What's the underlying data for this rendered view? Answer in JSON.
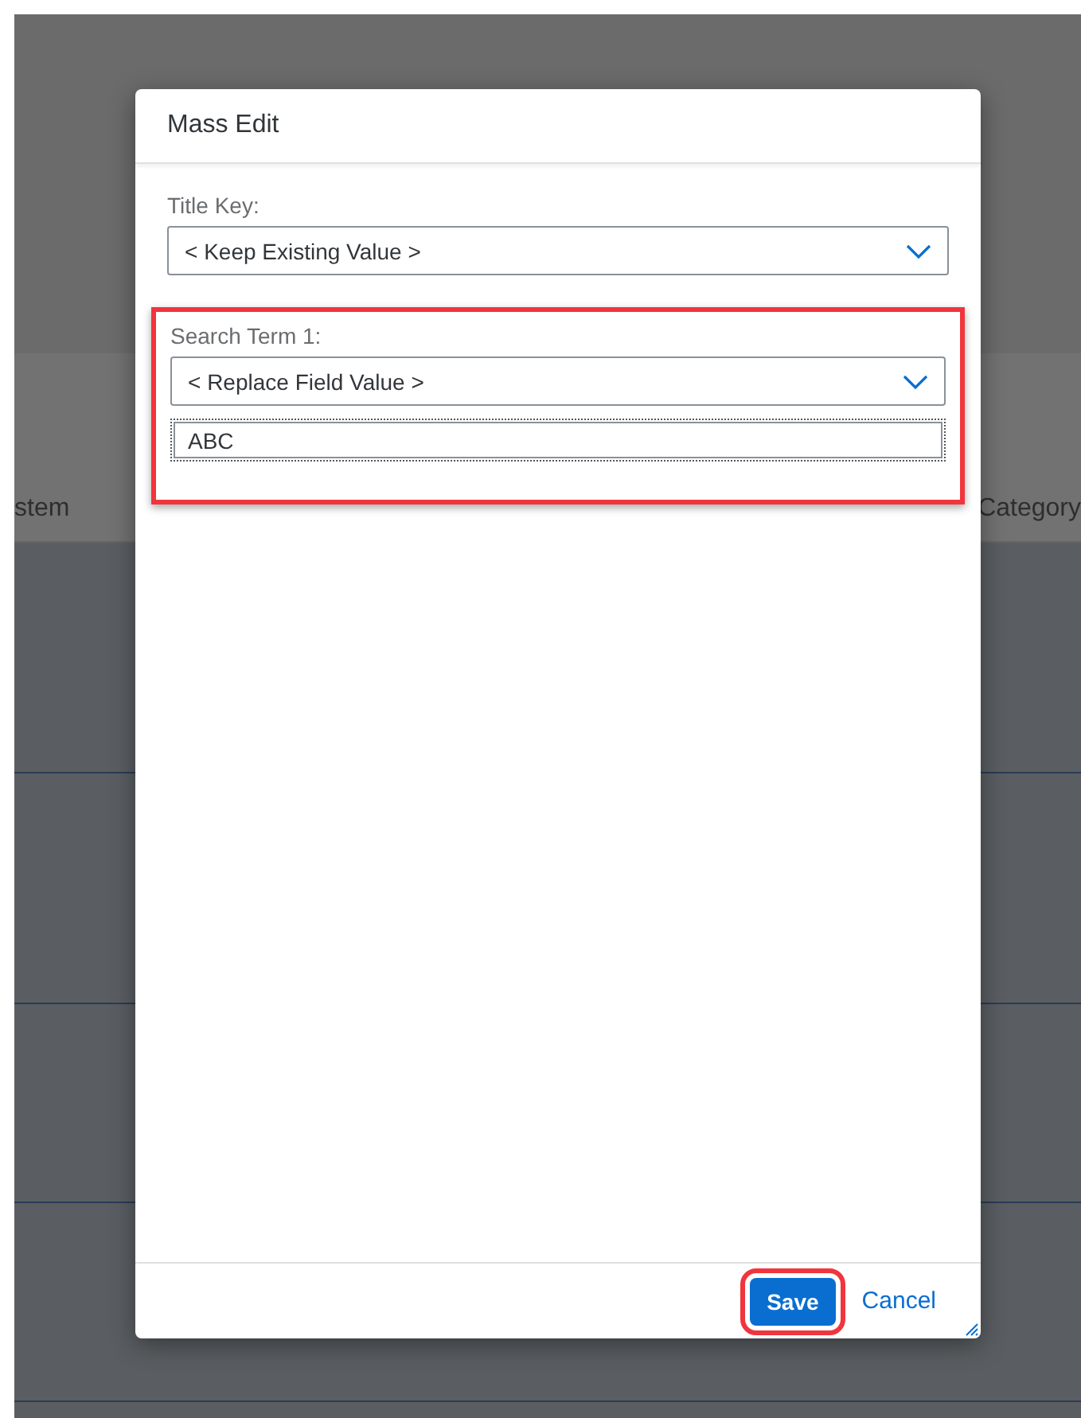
{
  "background": {
    "columns": [
      {
        "label": "stem"
      },
      {
        "label": "Category"
      }
    ]
  },
  "dialog": {
    "title": "Mass Edit",
    "fields": [
      {
        "label": "Title Key:",
        "value": "< Keep Existing Value >",
        "highlighted": false
      },
      {
        "label": "Search Term 1:",
        "value": "< Replace Field Value >",
        "input": "ABC",
        "highlighted": true
      }
    ],
    "buttons": [
      {
        "label": "Save",
        "kind": "primary",
        "highlighted": true
      },
      {
        "label": "Cancel",
        "kind": "link",
        "highlighted": false
      }
    ]
  }
}
